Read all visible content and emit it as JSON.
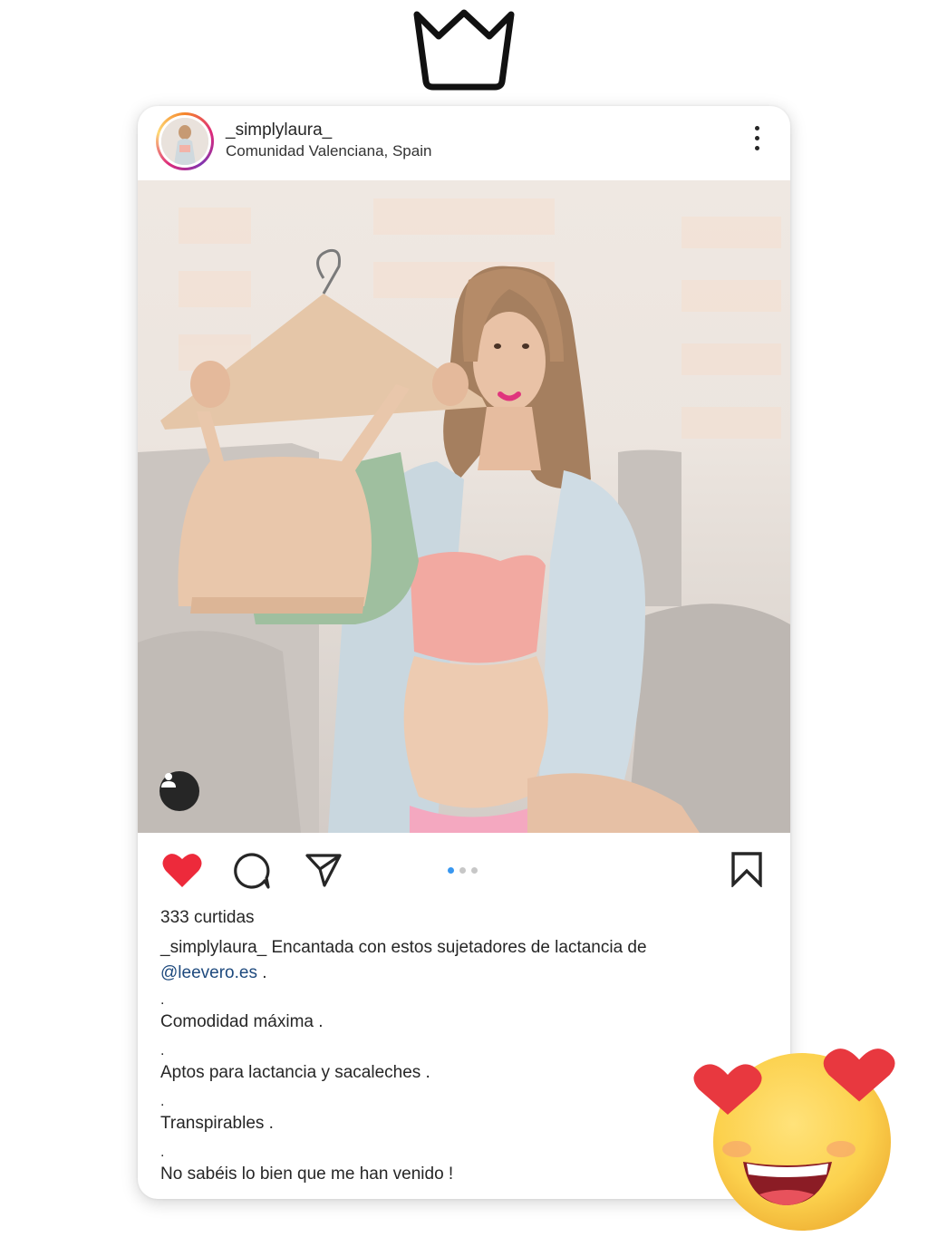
{
  "post": {
    "username": "_simplylaura_",
    "location": "Comunidad Valenciana, Spain",
    "likes": "333 curtidas",
    "caption_user": "_simplylaura_",
    "caption_text": " Encantada con estos sujetadores de lactancia de",
    "mention": "@leevero.es",
    "mention_suffix": " .",
    "lines": [
      {
        "dot": ".",
        "text": "Comodidad máxima ."
      },
      {
        "dot": ".",
        "text": "Aptos para lactancia y sacaleches ."
      },
      {
        "dot": ".",
        "text": "Transpirables ."
      },
      {
        "dot": ".",
        "text": "No sabéis lo bien que me han venido !"
      }
    ],
    "carousel": {
      "count": 3,
      "active_index": 0
    },
    "liked": true
  },
  "icons": {
    "top": "crown-icon",
    "more": "more-options-icon",
    "like": "heart-icon",
    "comment": "comment-icon",
    "share": "send-icon",
    "save": "bookmark-icon",
    "tag": "user-tag-icon",
    "emoji": "heart-eyes-emoji"
  },
  "colors": {
    "like": "#ed2a3b",
    "carousel_active": "#3897f0",
    "mention": "#1e4a7e"
  }
}
